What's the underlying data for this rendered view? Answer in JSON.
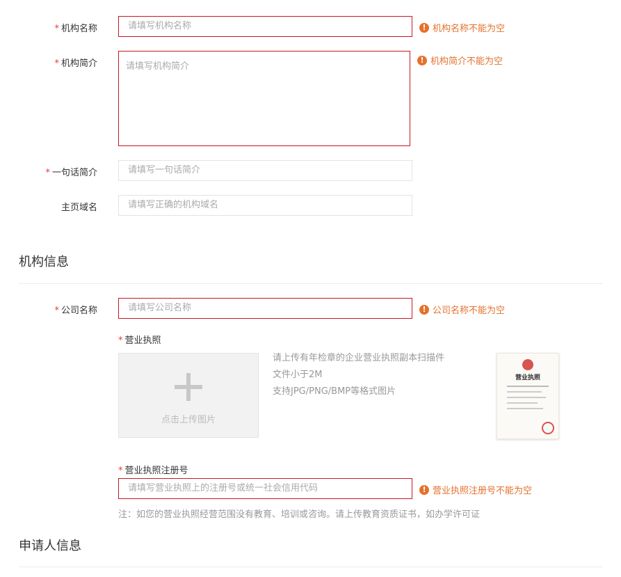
{
  "form": {
    "org_name": {
      "label": "机构名称",
      "placeholder": "请填写机构名称",
      "error": "机构名称不能为空"
    },
    "org_intro": {
      "label": "机构简介",
      "placeholder": "请填写机构简介",
      "error": "机构简介不能为空"
    },
    "one_line_intro": {
      "label": "一句话简介",
      "placeholder": "请填写一句话简介"
    },
    "homepage_domain": {
      "label": "主页域名",
      "placeholder": "请填写正确的机构域名"
    }
  },
  "org_info": {
    "section_title": "机构信息",
    "company_name": {
      "label": "公司名称",
      "placeholder": "请填写公司名称",
      "error": "公司名称不能为空"
    },
    "business_license": {
      "label": "营业执照",
      "upload_label": "点击上传图片",
      "hints": [
        "请上传有年检章的企业营业执照副本扫描件",
        "文件小于2M",
        "支持JPG/PNG/BMP等格式图片"
      ],
      "sample_title": "营业执照"
    },
    "license_reg_no": {
      "label": "营业执照注册号",
      "placeholder": "请填写营业执照上的注册号或统一社会信用代码",
      "error": "营业执照注册号不能为空",
      "note": "注：如您的营业执照经营范围没有教育、培训或咨询。请上传教育资质证书，如办学许可证"
    }
  },
  "applicant_info": {
    "section_title": "申请人信息"
  },
  "required_mark": "*",
  "error_icon": "!",
  "colors": {
    "error_border": "#c81623",
    "error_text": "#e4722d",
    "required": "#e4393c"
  }
}
